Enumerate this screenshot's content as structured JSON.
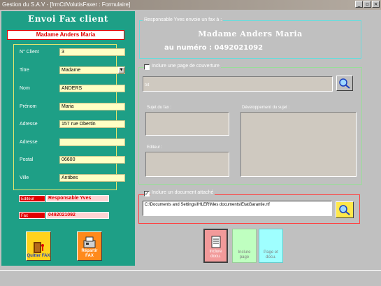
{
  "window": {
    "title": "Gestion du S.A.V - [frmCtlVolutisFaxer : Formulaire]",
    "buttons": [
      "_",
      "▫",
      "×"
    ]
  },
  "left": {
    "title": "Envoi Fax client",
    "client_name": "Madame Anders Maria",
    "fields": [
      {
        "label": "N° Client",
        "value": "3"
      },
      {
        "label": "Titre",
        "value": "Madame"
      },
      {
        "label": "Nom",
        "value": "ANDERS"
      },
      {
        "label": "Prénom",
        "value": "Maria"
      },
      {
        "label": "Adresse",
        "value": "157 rue Obertin"
      },
      {
        "label": "Adresse",
        "value": ""
      },
      {
        "label": "Postal",
        "value": "06600"
      },
      {
        "label": "Ville",
        "value": "Antibes"
      }
    ],
    "editeur_label": "Editeur",
    "editeur_value": "Responsable Yves",
    "fax_label": "Fax",
    "fax_value": "0492021092",
    "quit_label": "Quitter FAX",
    "send_label": "Répartir FAX"
  },
  "responsable": {
    "legend": "Responsable Yves  envoie un fax à :",
    "name": "Madame Anders Maria",
    "number": "au numéro :  0492021092"
  },
  "cover": {
    "checkbox_label": "Inclure une page de couverture",
    "path": "txt",
    "sujet_label": "Sujet du fax :",
    "dev_label": "Développement du sujet :",
    "editeur_label": "Editeur :"
  },
  "attach": {
    "checkbox_label": "Inclure un document attaché",
    "checked": true,
    "path": "C:\\Documents and Settings\\IHLER\\Mes documents\\EtatGarantie.rtf"
  },
  "actions": {
    "include_doc": "Inclure docu.",
    "include_page": "Inclure page",
    "page_doc": "Page et docu."
  },
  "colors": {
    "panel": "#1e9f86",
    "accent_red": "#e00000",
    "input_yellow": "#ffffc4"
  }
}
